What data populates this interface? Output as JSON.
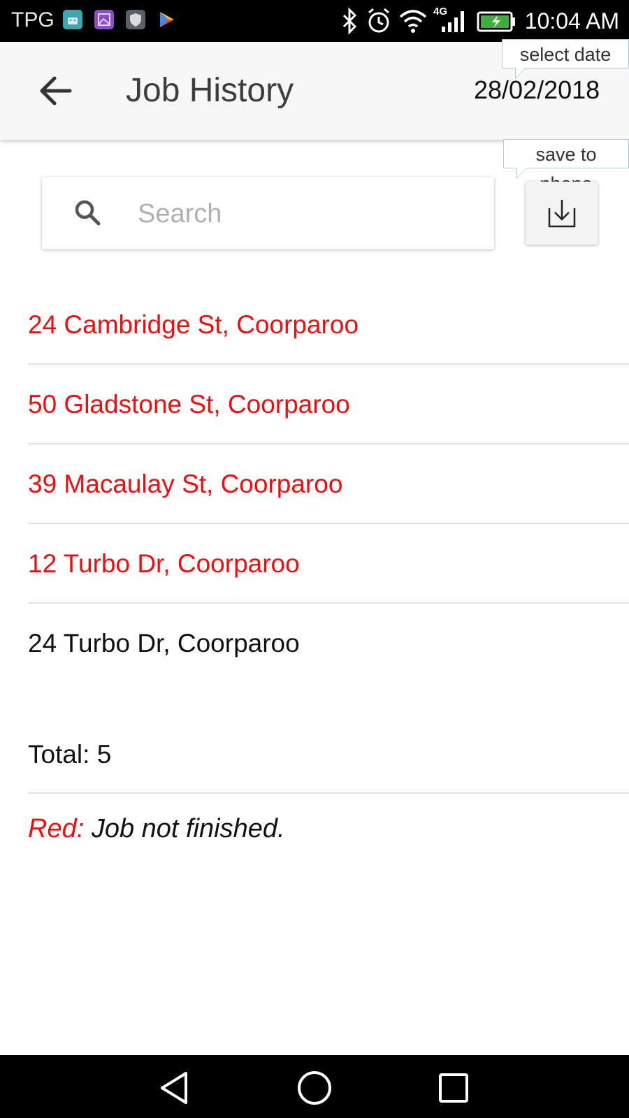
{
  "status_bar": {
    "carrier": "TPG",
    "time": "10:04 AM",
    "network_type": "4G",
    "icons": [
      "android-icon",
      "gallery-icon",
      "shield-icon",
      "play-store-icon",
      "bluetooth-icon",
      "alarm-icon",
      "wifi-icon",
      "signal-icon",
      "battery-charging-icon"
    ]
  },
  "header": {
    "title": "Job History",
    "date": "28/02/2018",
    "date_tooltip": "select date"
  },
  "search": {
    "placeholder": "Search",
    "value": ""
  },
  "save": {
    "tooltip": "save to phone"
  },
  "jobs": [
    {
      "address": "24 Cambridge St, Coorparoo",
      "status": "unfinished"
    },
    {
      "address": "50 Gladstone St, Coorparoo",
      "status": "unfinished"
    },
    {
      "address": "39 Macaulay St, Coorparoo",
      "status": "unfinished"
    },
    {
      "address": "12 Turbo Dr, Coorparoo",
      "status": "unfinished"
    },
    {
      "address": "24 Turbo Dr, Coorparoo",
      "status": "finished"
    }
  ],
  "summary": {
    "total_label": "Total: 5"
  },
  "legend": {
    "key": "Red:",
    "text": " Job not finished."
  },
  "colors": {
    "unfinished": "#f00d0d",
    "app_bar": "#f7f7f7"
  }
}
